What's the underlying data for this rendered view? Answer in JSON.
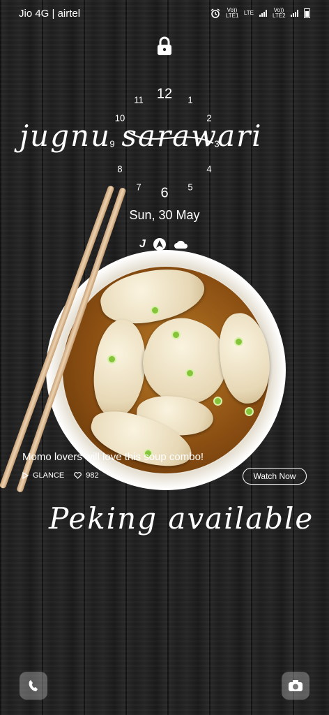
{
  "status_bar": {
    "carrier": "Jio 4G | airtel",
    "sim1_label": "Vo)) LTE1",
    "lte_label": "LTE",
    "sim2_label": "Vo)) LTE2"
  },
  "clock": {
    "numbers": [
      "12",
      "1",
      "2",
      "3",
      "4",
      "5",
      "6",
      "7",
      "8",
      "9",
      "10",
      "11"
    ],
    "date": "Sun, 30 May"
  },
  "handwritten": {
    "signature": "jugnu sarawari",
    "caption": "Peking available"
  },
  "glance": {
    "title": "Momo lovers will love this soup combo!",
    "source": "GLANCE",
    "likes": "982",
    "cta": "Watch Now"
  },
  "colors": {
    "accent": "#ffffff",
    "scallion": "#86c43c",
    "broth": "#8a4e12"
  }
}
